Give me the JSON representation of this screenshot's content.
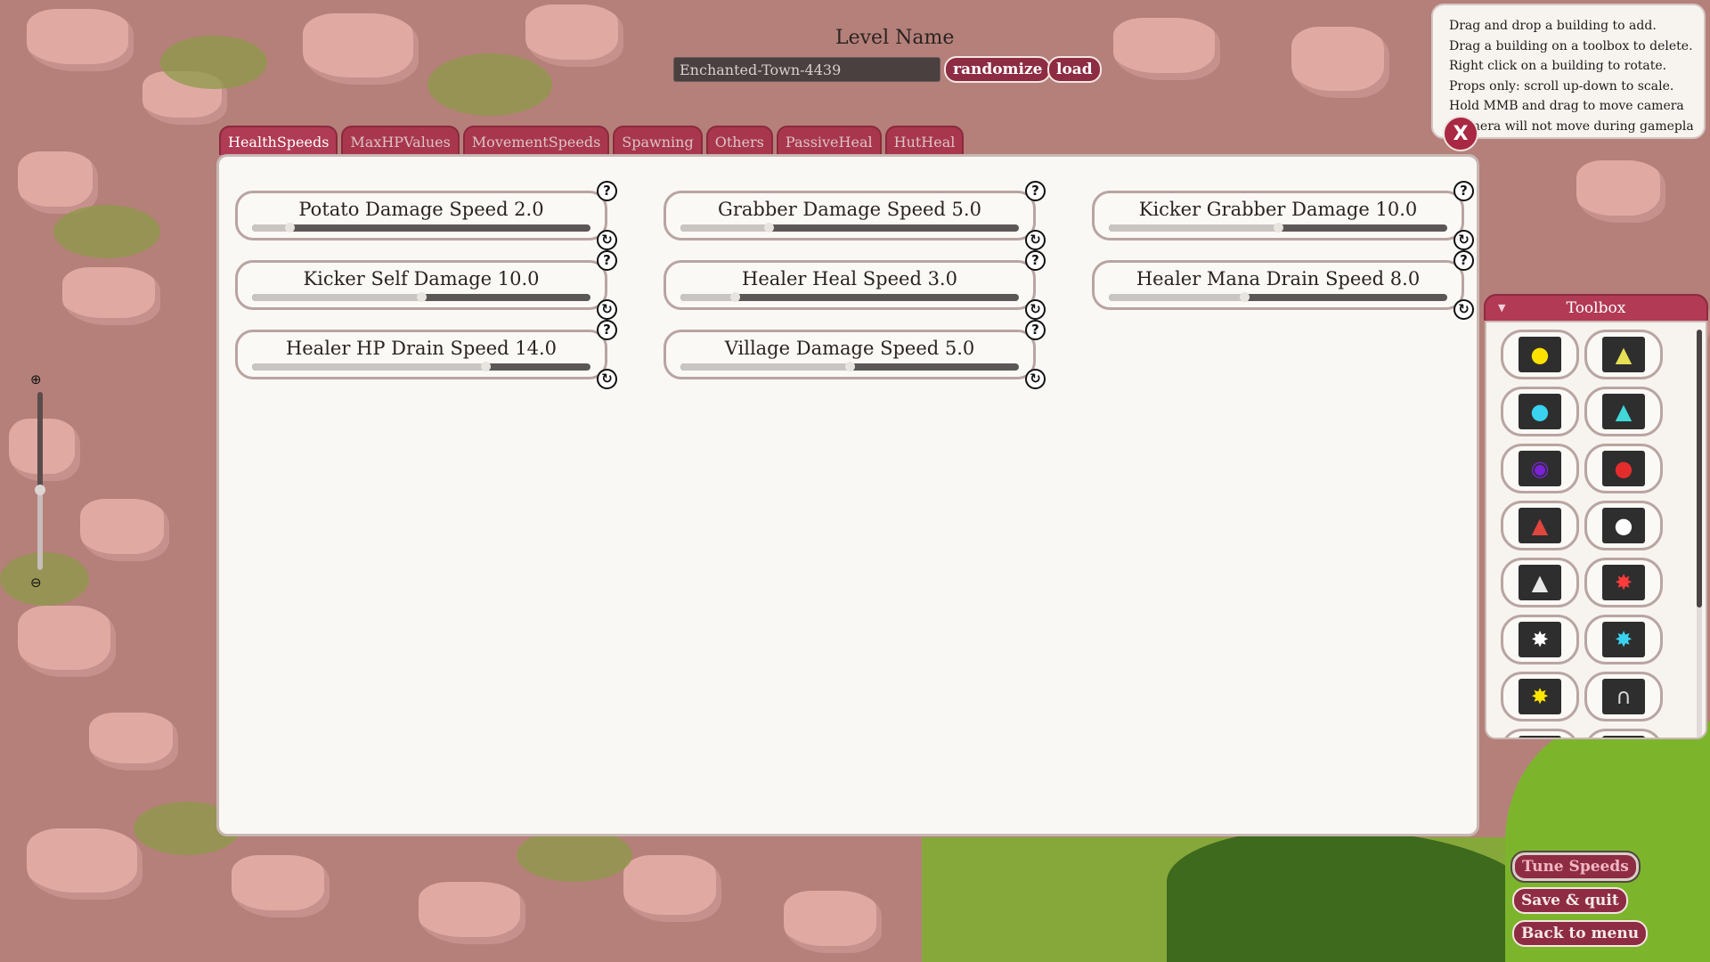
{
  "level": {
    "title": "Level Name",
    "name_value": "Enchanted-Town-4439",
    "randomize_label": "randomize",
    "load_label": "load"
  },
  "help": {
    "lines": [
      "Drag and drop a building to add.",
      "Drag a building on a toolbox to delete.",
      "Right click on a building to rotate.",
      "Props only: scroll up-down to scale.",
      "Hold MMB and drag to move camera",
      "(camera will not move during gameplay)"
    ],
    "close_label": "X"
  },
  "tabs": [
    {
      "label": "HealthSpeeds",
      "active": true
    },
    {
      "label": "MaxHPValues",
      "active": false
    },
    {
      "label": "MovementSpeeds",
      "active": false
    },
    {
      "label": "Spawning",
      "active": false
    },
    {
      "label": "Others",
      "active": false
    },
    {
      "label": "PassiveHeal",
      "active": false
    },
    {
      "label": "HutHeal",
      "active": false
    }
  ],
  "sliders": [
    {
      "label": "Potato Damage Speed 2.0",
      "fraction": 0.11
    },
    {
      "label": "Grabber Damage Speed 5.0",
      "fraction": 0.26
    },
    {
      "label": "Kicker Grabber Damage 10.0",
      "fraction": 0.5
    },
    {
      "label": "Kicker Self Damage 10.0",
      "fraction": 0.5
    },
    {
      "label": "Healer Heal Speed 3.0",
      "fraction": 0.16
    },
    {
      "label": "Healer Mana Drain Speed 8.0",
      "fraction": 0.4
    },
    {
      "label": "Healer HP Drain Speed 14.0",
      "fraction": 0.69
    },
    {
      "label": "Village Damage Speed 5.0",
      "fraction": 0.5
    }
  ],
  "zoom": {
    "level": 0.45
  },
  "toolbox": {
    "title": "Toolbox",
    "items": [
      {
        "icon": "yellow-blob-icon",
        "color": "#ffe100"
      },
      {
        "icon": "yellow-hut-icon",
        "color": "#e6e055"
      },
      {
        "icon": "cyan-blob-icon",
        "color": "#39d2f0"
      },
      {
        "icon": "cyan-hut-icon",
        "color": "#3fd9d9"
      },
      {
        "icon": "purple-portal-icon",
        "color": "#7a22d8"
      },
      {
        "icon": "red-blob-icon",
        "color": "#e52c2c"
      },
      {
        "icon": "red-hut-icon",
        "color": "#e0453e"
      },
      {
        "icon": "white-blob-icon",
        "color": "#ffffff"
      },
      {
        "icon": "white-hut-icon",
        "color": "#e8e8e8"
      },
      {
        "icon": "red-splat-icon",
        "color": "#ff3b3b"
      },
      {
        "icon": "white-splat-icon",
        "color": "#ffffff"
      },
      {
        "icon": "cyan-splat-icon",
        "color": "#39d2f0"
      },
      {
        "icon": "yellow-splat-icon",
        "color": "#ffe600"
      },
      {
        "icon": "archway-icon",
        "color": "#d8d8d8"
      },
      {
        "icon": "partial-item-icon",
        "color": "#555555"
      },
      {
        "icon": "partial-item-icon",
        "color": "#555555"
      }
    ]
  },
  "buttons": {
    "tune_speeds": "Tune Speeds",
    "save_quit": "Save & quit",
    "back_to_menu": "Back to menu"
  },
  "colors": {
    "accent": "#8e2c43",
    "tab": "#a8374e",
    "panel": "#faf8f4"
  }
}
